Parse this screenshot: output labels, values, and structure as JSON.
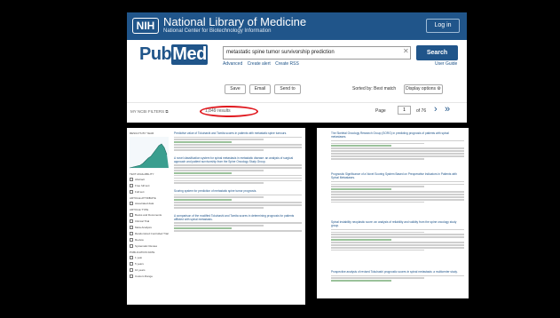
{
  "header": {
    "logo": "NIH",
    "title": "National Library of Medicine",
    "subtitle": "National Center for Biotechnology Information",
    "login": "Log in"
  },
  "search": {
    "logo_pub": "Pub",
    "logo_med": "Med",
    "query": "metastatic spine tumor survivorship prediction",
    "button": "Search",
    "links": [
      "Advanced",
      "Create alert",
      "Create RSS"
    ],
    "user_guide": "User Guide"
  },
  "actions": {
    "save": "Save",
    "email": "Email",
    "send_to": "Send to",
    "sorted_by": "Sorted by: Best match",
    "display_options": "Display options"
  },
  "results": {
    "my_ncbi": "MY NCBI FILTERS",
    "count": "1,849 results",
    "page_label": "Page",
    "page_value": "1",
    "page_of": "of 76",
    "highlight_color": "#e0191f"
  },
  "left_panel": {
    "sidebar_labels": [
      "RESULTS BY YEAR",
      "TEXT AVAILABILITY",
      "ARTICLE ATTRIBUTE",
      "ARTICLE TYPE",
      "PUBLICATION DATE"
    ],
    "checkboxes": [
      "Abstract",
      "Free full text",
      "Full text",
      "Associated data",
      "Books and Documents",
      "Clinical Trial",
      "Meta-Analysis",
      "Randomized Controlled Trial",
      "Review",
      "Systematic Review",
      "1 year",
      "5 years",
      "10 years",
      "Custom Range"
    ],
    "items": [
      "Predictive value of Tokuhashi and Tomita scores in patients with metastatic spine tumours.",
      "A novel classification system for spinal metastasis in metastatic disease: an analysis of surgical approach and patient survivorship from the Spine Oncology Study Group.",
      "Scoring system for prediction of metastatic spine tumor prognosis.",
      "A comparison of the modified Tokuhashi and Tomita scores in determining prognosis for patients afflicted with spinal metastasis."
    ]
  },
  "right_panel": {
    "items": [
      "The Skeletal Oncology Research Group (SORG) in predicting prognosis of patients with spinal metastases.",
      "Prognostic Significance of a Novel Scoring System Based on Preoperative Indicators in Patients with Spinal Metastases.",
      "Spinal instability neoplastic score: an analysis of reliability and validity from the spine oncology study group.",
      "Prospective analysis of revised Tokuhashi prognostic scores in spinal metastasis: a multicenter study."
    ]
  }
}
